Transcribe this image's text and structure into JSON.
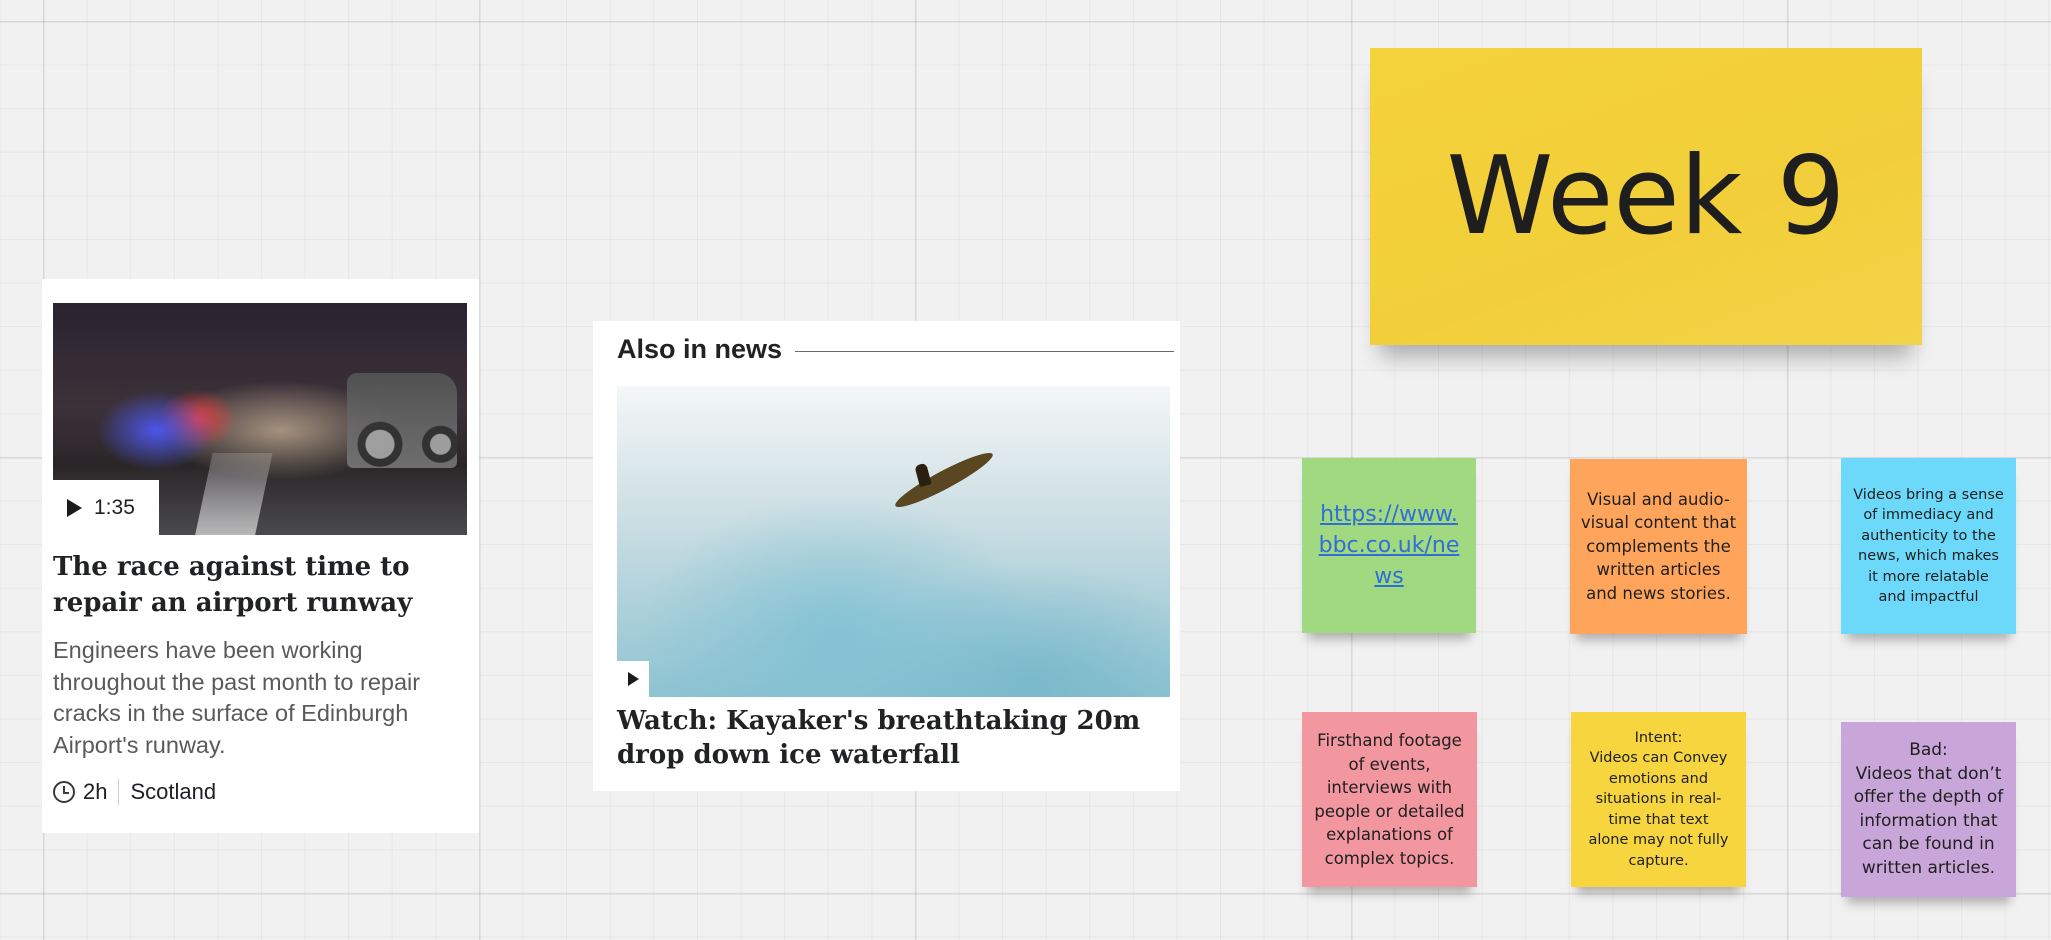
{
  "news_card_1": {
    "video_duration": "1:35",
    "headline": "The race against time to repair an airport runway",
    "summary": "Engineers have been working throughout the past month to repair cracks in the surface of Edinburgh Airport's runway.",
    "time_ago": "2h",
    "section": "Scotland"
  },
  "news_card_2": {
    "section_title": "Also in news",
    "headline": "Watch: Kayaker's breathtaking 20m drop down ice waterfall"
  },
  "stickies": {
    "title": "Week 9",
    "link": "https://www.bbc.co.uk/news",
    "orange": "Visual and audio-visual content that complements the written articles and news stories.",
    "blue": "Videos bring a sense of immediacy and authenticity to the news, which makes it more relatable and impactful",
    "pink": "Firsthand footage of events, interviews with people or detailed explanations of complex topics.",
    "yellow": "Intent:\nVideos can Convey emotions and situations in real-time that text alone may not fully capture.",
    "purple": "Bad:\nVideos that don’t offer the depth of information that can be found in written articles."
  },
  "colors": {
    "canvas": "#f1f1f1",
    "week_note": "#f2cf3a",
    "green": "#a1d981",
    "orange": "#fea55b",
    "blue": "#6cd8fa",
    "pink": "#f2969f",
    "yellow": "#f6d53f",
    "purple": "#c9a6d9",
    "link": "#2f6fd6"
  },
  "icons": {
    "play": "play-icon",
    "clock": "clock-icon"
  }
}
